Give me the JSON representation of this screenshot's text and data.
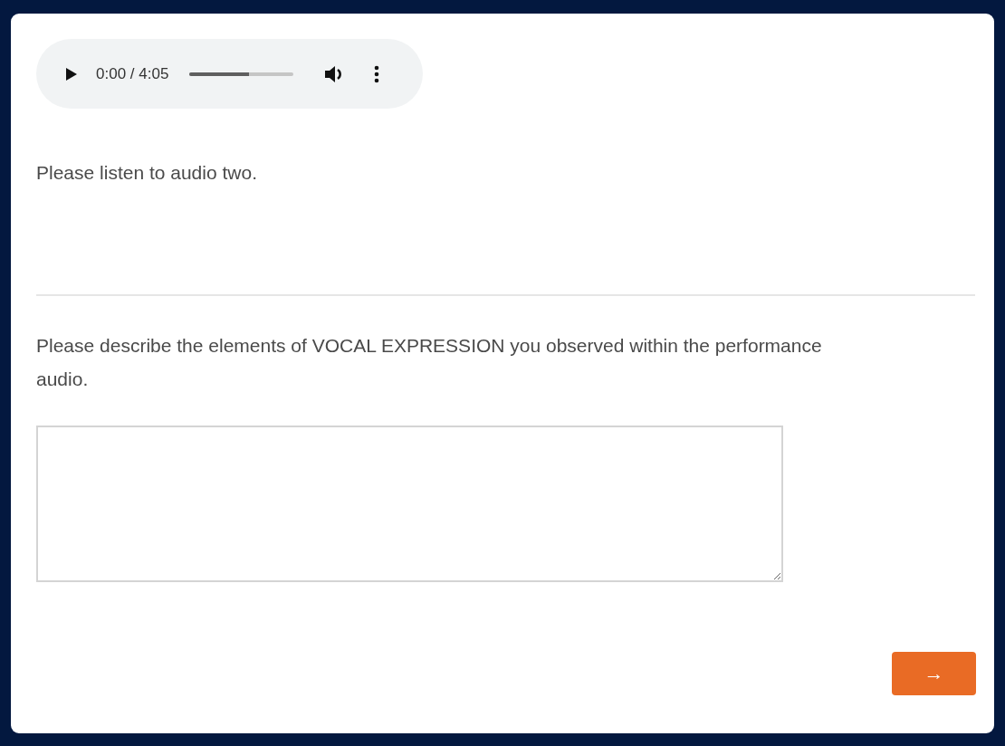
{
  "audio_player": {
    "time": "0:00 / 4:05",
    "level": 0.57
  },
  "intro": "Please listen to audio two.",
  "question": "Please describe the elements of VOCAL EXPRESSION you observed within the performance audio.",
  "next_button": "→"
}
